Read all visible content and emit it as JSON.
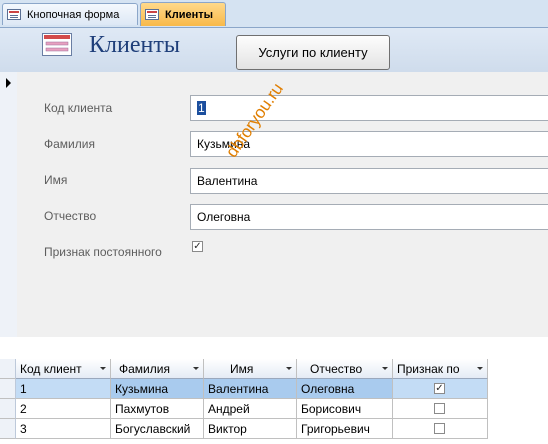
{
  "tabs": [
    {
      "label": "Кнопочная форма",
      "active": false
    },
    {
      "label": "Клиенты",
      "active": true
    }
  ],
  "header": {
    "title": "Клиенты",
    "button_label": "Услуги по клиенту"
  },
  "fields": {
    "client_code": {
      "label": "Код клиента",
      "value": "1"
    },
    "last_name": {
      "label": "Фамилия",
      "value": "Кузьмина"
    },
    "first_name": {
      "label": "Имя",
      "value": "Валентина"
    },
    "patronymic": {
      "label": "Отчество",
      "value": "Олеговна"
    },
    "regular": {
      "label": "Признак постоянного",
      "checked": true
    }
  },
  "watermark": "dbforyou.ru",
  "table": {
    "columns": [
      "Код клиент",
      "Фамилия",
      "Имя",
      "Отчество",
      "Признак по"
    ],
    "rows": [
      {
        "code": "1",
        "last_name": "Кузьмина",
        "first_name": "Валентина",
        "patronymic": "Олеговна",
        "regular": true
      },
      {
        "code": "2",
        "last_name": "Пахмутов",
        "first_name": "Андрей",
        "patronymic": "Борисович",
        "regular": false
      },
      {
        "code": "3",
        "last_name": "Богуславский",
        "first_name": "Виктор",
        "patronymic": "Григорьевич",
        "regular": false
      }
    ]
  },
  "icons": {
    "form_icon": "form-icon",
    "check_mark": "✓",
    "record_pointer": "arrow-right-icon"
  },
  "colors": {
    "active_tab": "#f8b94a",
    "title": "#1f3f7a",
    "watermark": "#e07e00",
    "selected_row": "#c3dcf5"
  }
}
